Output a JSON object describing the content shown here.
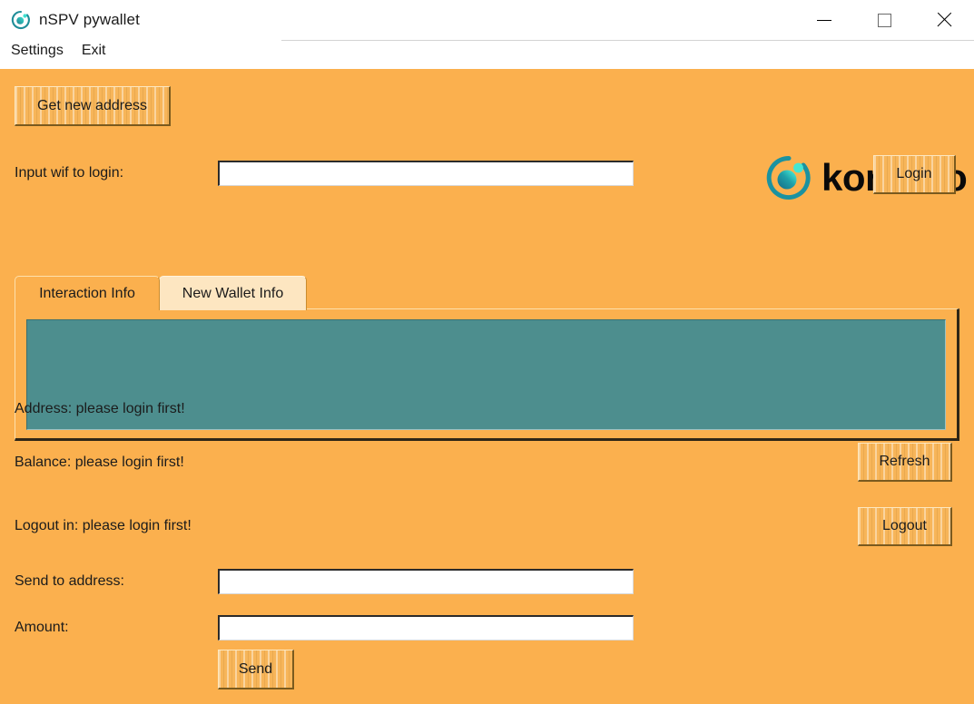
{
  "window": {
    "title": "nSPV pywallet",
    "app_icon": "komodo-circle-icon",
    "controls": {
      "minimize": "minimize-icon",
      "maximize": "maximize-icon",
      "close": "close-icon"
    }
  },
  "menu": {
    "items": [
      {
        "label": "Settings"
      },
      {
        "label": "Exit"
      }
    ]
  },
  "brand": {
    "wordmark": "komodo",
    "mark_icon": "komodo-logo-icon"
  },
  "toolbar": {
    "get_new_address_label": "Get new address"
  },
  "login": {
    "wif_label": "Input wif to login:",
    "wif_value": "",
    "wif_placeholder": "",
    "login_button_label": "Login"
  },
  "tabs": [
    {
      "label": "Interaction Info",
      "active": true
    },
    {
      "label": "New Wallet Info",
      "active": false
    }
  ],
  "console": {
    "text": ""
  },
  "status": {
    "address_line": "Address: please login first!",
    "balance_line": "Balance: please login first!",
    "logout_line": "Logout in: please login first!",
    "refresh_button_label": "Refresh",
    "logout_button_label": "Logout"
  },
  "send": {
    "address_label": "Send to address:",
    "address_value": "",
    "address_placeholder": "",
    "amount_label": "Amount:",
    "amount_value": "",
    "amount_placeholder": "",
    "send_button_label": "Send"
  },
  "colors": {
    "background": "#fbb04e",
    "console": "#4d8e8e",
    "tab_inactive": "#fde6c1",
    "brand_teal": "#1f9e9e",
    "brand_cyan": "#3ce0d0",
    "text": "#1b1b1b"
  }
}
